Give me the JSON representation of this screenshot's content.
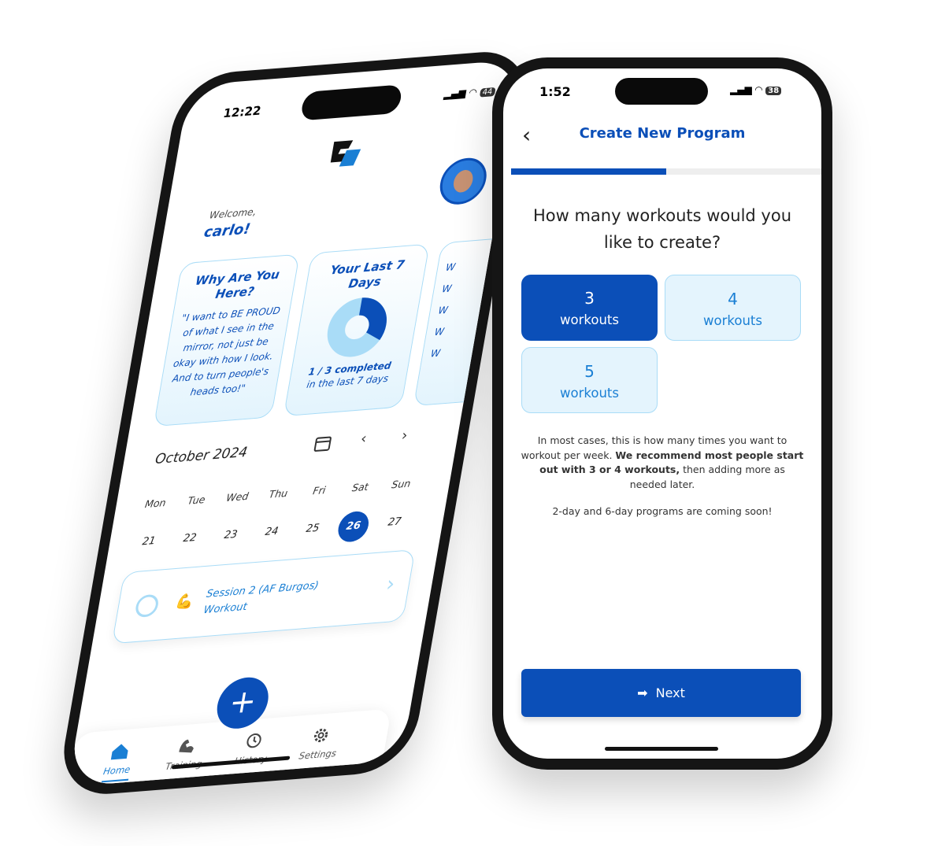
{
  "left_phone": {
    "status": {
      "time": "12:22",
      "battery": "44"
    },
    "welcome": "Welcome,",
    "user_name": "carlo!",
    "cards": [
      {
        "title": "Why Are You Here?",
        "body": "\"I want to BE PROUD of what I see in the mirror, not just be okay with how I look. And to turn people's heads too!\""
      },
      {
        "title": "Your Last 7 Days",
        "completed": "1 / 3 completed",
        "period": "in the last 7 days",
        "progress_fraction": 0.333
      }
    ],
    "third_card_fragments": [
      "W",
      "W",
      "W",
      "W",
      "W"
    ],
    "calendar": {
      "month": "October 2024",
      "weekdays": [
        "Mon",
        "Tue",
        "Wed",
        "Thu",
        "Fri",
        "Sat",
        "Sun"
      ],
      "dates": [
        "21",
        "22",
        "23",
        "24",
        "25",
        "26",
        "27"
      ],
      "selected": "26"
    },
    "session": {
      "title": "Session 2 (AF Burgos)",
      "subtitle": "Workout"
    },
    "nav": [
      {
        "label": "Home",
        "icon": "home-icon",
        "active": true
      },
      {
        "label": "Training",
        "icon": "bicep-icon"
      },
      {
        "label": "History",
        "icon": "history-icon"
      },
      {
        "label": "Settings",
        "icon": "gear-icon"
      }
    ],
    "fab_icon": "plus-icon"
  },
  "right_phone": {
    "status": {
      "time": "1:52",
      "battery": "38"
    },
    "header_title": "Create New Program",
    "progress_fraction": 0.5,
    "question": "How many workouts would you like to create?",
    "options": [
      {
        "number": "3",
        "label": "workouts",
        "selected": true
      },
      {
        "number": "4",
        "label": "workouts",
        "selected": false
      },
      {
        "number": "5",
        "label": "workouts",
        "selected": false
      }
    ],
    "info_pre": "In most cases, this is how many times you want to workout per week. ",
    "info_bold": "We recommend most people start out with 3 or 4 workouts,",
    "info_post": " then adding more as needed later.",
    "coming_soon": "2-day and 6-day programs are coming soon!",
    "next_label": "Next"
  },
  "colors": {
    "primary": "#0b4fb8",
    "light": "#e4f4fd",
    "accent": "#1a7fd4"
  }
}
